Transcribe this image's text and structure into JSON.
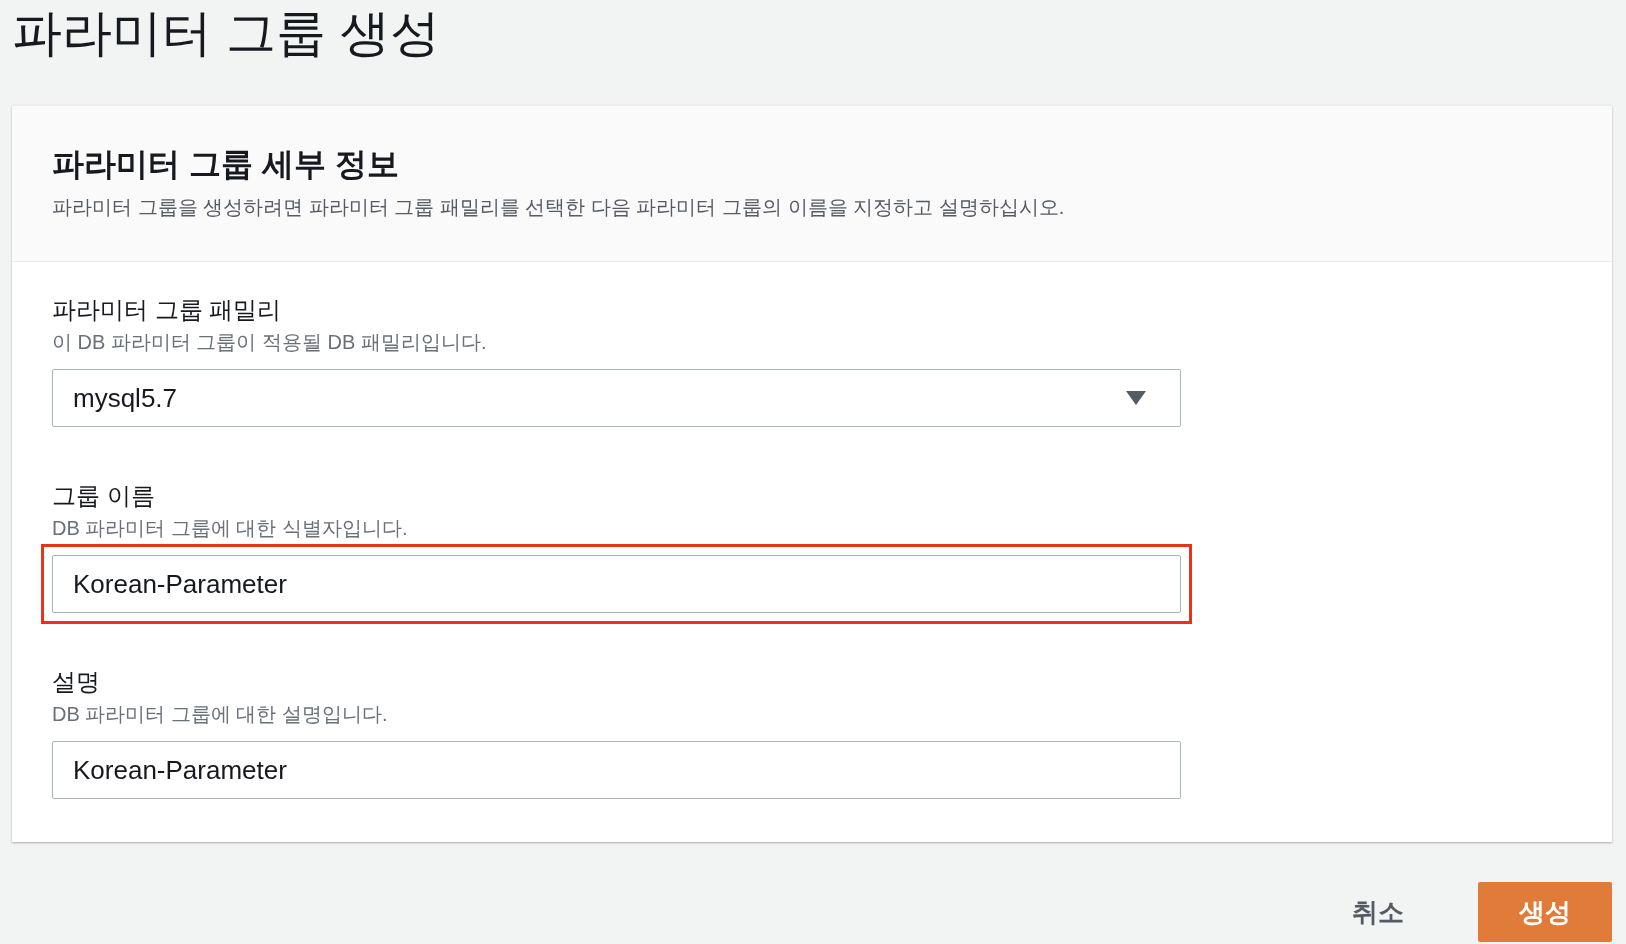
{
  "page_title": "파라미터 그룹 생성",
  "card": {
    "heading": "파라미터 그룹 세부 정보",
    "description": "파라미터 그룹을 생성하려면 파라미터 그룹 패밀리를 선택한 다음 파라미터 그룹의 이름을 지정하고 설명하십시오."
  },
  "fields": [
    {
      "kind": "select",
      "label": "파라미터 그룹 패밀리",
      "hint": "이 DB 파라미터 그룹이 적용될 DB 패밀리입니다.",
      "value": "mysql5.7",
      "highlighted": false
    },
    {
      "kind": "text",
      "label": "그룹 이름",
      "hint": "DB 파라미터 그룹에 대한 식별자입니다.",
      "value": "Korean-Parameter",
      "highlighted": true
    },
    {
      "kind": "text",
      "label": "설명",
      "hint": "DB 파라미터 그룹에 대한 설명입니다.",
      "value": "Korean-Parameter",
      "highlighted": false
    }
  ],
  "buttons": [
    {
      "kind": "link",
      "label": "취소"
    },
    {
      "kind": "primary",
      "label": "생성"
    }
  ]
}
